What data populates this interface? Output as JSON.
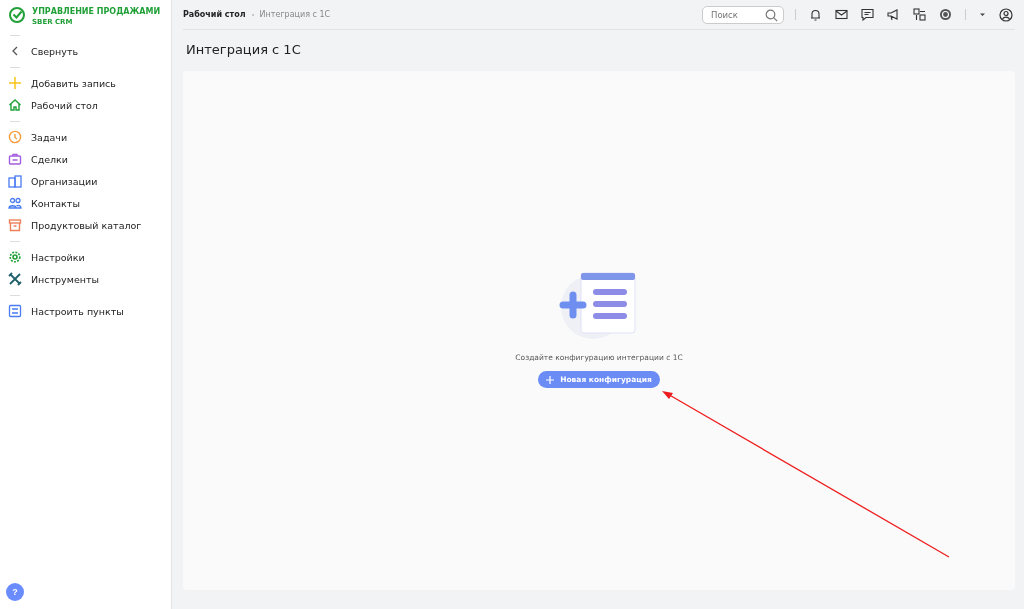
{
  "brand": {
    "title": "УПРАВЛЕНИЕ ПРОДАЖАМИ",
    "subtitle": "SBER CRM"
  },
  "sidebar": {
    "groups": [
      {
        "items": [
          {
            "kind": "collapse",
            "label": "Свернуть"
          }
        ]
      },
      {
        "items": [
          {
            "kind": "add",
            "label": "Добавить запись"
          },
          {
            "kind": "home",
            "label": "Рабочий стол"
          }
        ]
      },
      {
        "items": [
          {
            "kind": "tasks",
            "label": "Задачи"
          },
          {
            "kind": "deals",
            "label": "Сделки"
          },
          {
            "kind": "orgs",
            "label": "Организации"
          },
          {
            "kind": "contacts",
            "label": "Контакты"
          },
          {
            "kind": "catalog",
            "label": "Продуктовый каталог"
          }
        ]
      },
      {
        "items": [
          {
            "kind": "settings",
            "label": "Настройки"
          },
          {
            "kind": "tools",
            "label": "Инструменты"
          }
        ]
      },
      {
        "items": [
          {
            "kind": "customize",
            "label": "Настроить пункты"
          }
        ]
      }
    ],
    "help": "?"
  },
  "breadcrumbs": [
    {
      "label": "Рабочий стол",
      "current": false
    },
    {
      "label": "Интеграция с 1С",
      "current": true
    }
  ],
  "search": {
    "placeholder": "Поиск"
  },
  "page_title": "Интеграция с 1С",
  "empty_state": {
    "message": "Создайте конфигурацию интеграции с 1С",
    "button": "Новая конфигурация"
  }
}
